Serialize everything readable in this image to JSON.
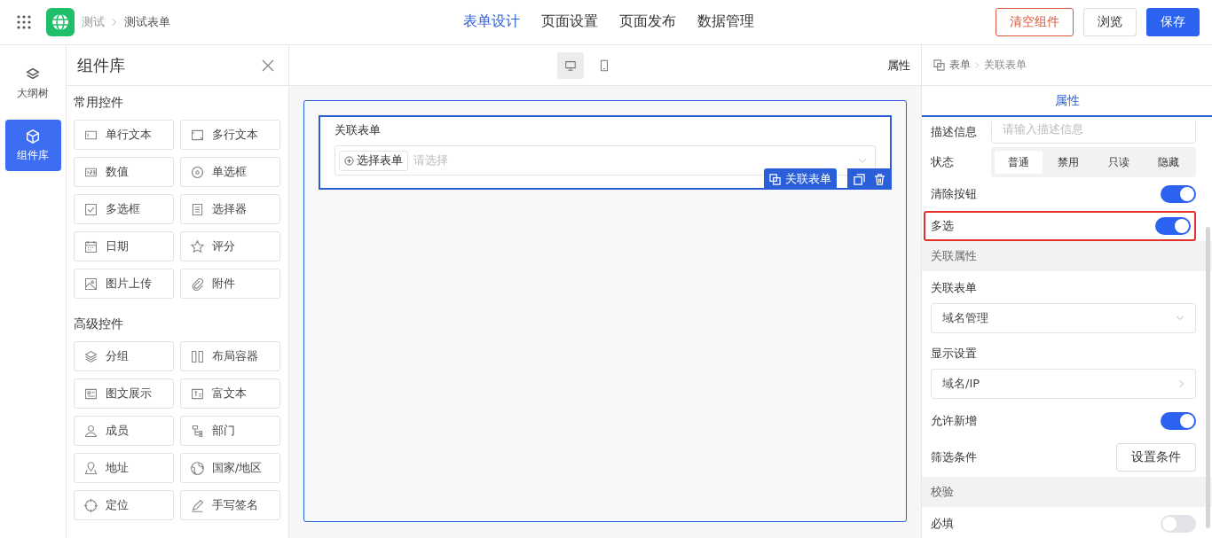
{
  "topbar": {
    "breadcrumb": [
      "测试",
      "测试表单"
    ],
    "tabs": [
      {
        "label": "表单设计",
        "selected": true
      },
      {
        "label": "页面设置",
        "selected": false
      },
      {
        "label": "页面发布",
        "selected": false
      },
      {
        "label": "数据管理",
        "selected": false
      }
    ],
    "buttons": [
      {
        "label": "清空组件",
        "kind": "danger"
      },
      {
        "label": "浏览",
        "kind": "default"
      },
      {
        "label": "保存",
        "kind": "primary"
      }
    ]
  },
  "rail": [
    {
      "label": "大纲树",
      "selected": false
    },
    {
      "label": "组件库",
      "selected": true
    }
  ],
  "library": {
    "title": "组件库",
    "groups": [
      {
        "title": "常用控件",
        "items": [
          "单行文本",
          "多行文本",
          "数值",
          "单选框",
          "多选框",
          "选择器",
          "日期",
          "评分",
          "图片上传",
          "附件"
        ]
      },
      {
        "title": "高级控件",
        "items": [
          "分组",
          "布局容器",
          "图文展示",
          "富文本",
          "成员",
          "部门",
          "地址",
          "国家/地区",
          "定位",
          "手写签名"
        ]
      }
    ]
  },
  "canvas": {
    "devices": [
      {
        "selected": true
      },
      {
        "selected": false
      }
    ],
    "header_label": "属性",
    "field": {
      "label": "关联表单",
      "select_button": "选择表单",
      "placeholder": "请选择",
      "tag": "关联表单"
    }
  },
  "properties": {
    "breadcrumb": [
      "表单",
      "关联表单"
    ],
    "tab": "属性",
    "rows": [
      {
        "kind": "textarea",
        "label": "描述信息",
        "placeholder": "请输入描述信息"
      },
      {
        "kind": "segmented",
        "label": "状态",
        "options": [
          {
            "label": "普通",
            "selected": true
          },
          {
            "label": "禁用",
            "selected": false
          },
          {
            "label": "只读",
            "selected": false
          },
          {
            "label": "隐藏",
            "selected": false
          }
        ]
      },
      {
        "kind": "toggle",
        "label": "清除按钮",
        "on": true,
        "highlighted": false
      },
      {
        "kind": "toggle",
        "label": "多选",
        "on": true,
        "highlighted": true
      },
      {
        "kind": "section",
        "label": "关联属性"
      },
      {
        "kind": "label",
        "label": "关联表单"
      },
      {
        "kind": "select",
        "value": "域名管理"
      },
      {
        "kind": "label",
        "label": "显示设置"
      },
      {
        "kind": "link",
        "value": "域名/IP"
      },
      {
        "kind": "toggle",
        "label": "允许新增",
        "on": true,
        "highlighted": false
      },
      {
        "kind": "button",
        "label": "筛选条件",
        "button": "设置条件"
      },
      {
        "kind": "section",
        "label": "校验"
      },
      {
        "kind": "toggle",
        "label": "必填",
        "on": false,
        "highlighted": false
      }
    ]
  }
}
